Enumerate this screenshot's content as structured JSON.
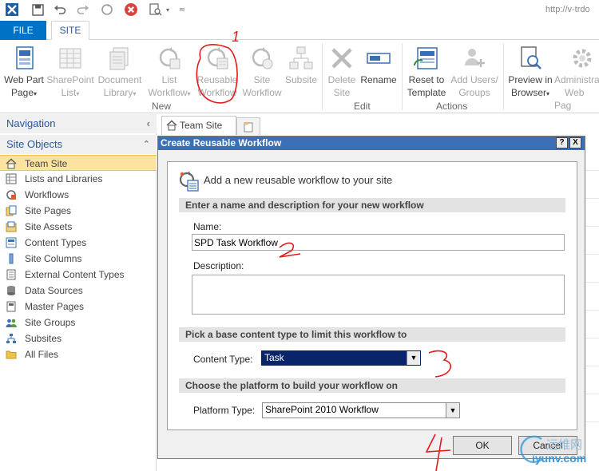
{
  "address": {
    "url": "http://v-trdo"
  },
  "quick_access": {
    "icons": [
      "sharepoint-designer-icon",
      "save-icon",
      "undo-icon",
      "redo-icon",
      "refresh-icon",
      "stop-icon",
      "preview-icon",
      "customize-icon"
    ]
  },
  "tabs": {
    "file": "FILE",
    "site": "SITE"
  },
  "ribbon": {
    "web_part_page": {
      "line1": "Web Part",
      "line2": "Page"
    },
    "sharepoint_list": {
      "line1": "SharePoint",
      "line2": "List"
    },
    "document_library": {
      "line1": "Document",
      "line2": "Library"
    },
    "list_workflow": {
      "line1": "List",
      "line2": "Workflow"
    },
    "reusable_workflow": {
      "line1": "Reusable",
      "line2": "Workflow"
    },
    "site_workflow": {
      "line1": "Site",
      "line2": "Workflow"
    },
    "subsite": {
      "line1": "Subsite"
    },
    "delete_site": {
      "line1": "Delete",
      "line2": "Site"
    },
    "rename": {
      "line1": "Rename"
    },
    "reset_to_template": {
      "line1": "Reset to",
      "line2": "Template"
    },
    "add_users_groups": {
      "line1": "Add Users/",
      "line2": "Groups"
    },
    "preview_in_browser": {
      "line1": "Preview in",
      "line2": "Browser"
    },
    "administration_web_page": {
      "line1": "Administra",
      "line2": "Web Pag"
    },
    "groups": {
      "new": "New",
      "edit": "Edit",
      "actions": "Actions"
    }
  },
  "navigation": {
    "header": "Navigation",
    "site_objects_header": "Site Objects",
    "items": [
      {
        "label": "Team Site",
        "icon": "home-icon"
      },
      {
        "label": "Lists and Libraries",
        "icon": "lists-icon"
      },
      {
        "label": "Workflows",
        "icon": "workflow-icon"
      },
      {
        "label": "Site Pages",
        "icon": "pages-icon"
      },
      {
        "label": "Site Assets",
        "icon": "assets-icon"
      },
      {
        "label": "Content Types",
        "icon": "content-types-icon"
      },
      {
        "label": "Site Columns",
        "icon": "columns-icon"
      },
      {
        "label": "External Content Types",
        "icon": "external-content-icon"
      },
      {
        "label": "Data Sources",
        "icon": "database-icon"
      },
      {
        "label": "Master Pages",
        "icon": "master-pages-icon"
      },
      {
        "label": "Site Groups",
        "icon": "users-icon"
      },
      {
        "label": "Subsites",
        "icon": "subsites-icon"
      },
      {
        "label": "All Files",
        "icon": "folder-icon"
      }
    ]
  },
  "doc_tab": {
    "label": "Team Site"
  },
  "dialog": {
    "title": "Create Reusable Workflow",
    "help_button": "?",
    "close_button": "X",
    "intro": "Add a new reusable workflow to your site",
    "section_name": "Enter a name and description for your new workflow",
    "name_label": "Name:",
    "name_value": "SPD Task Workflow",
    "description_label": "Description:",
    "description_value": "",
    "section_content_type": "Pick a base content type to limit this workflow to",
    "content_type_label": "Content Type:",
    "content_type_value": "Task",
    "section_platform": "Choose the platform to build your workflow on",
    "platform_label": "Platform Type:",
    "platform_value": "SharePoint 2010 Workflow",
    "ok": "OK",
    "cancel": "Cancel"
  },
  "annotations": [
    "1",
    "2",
    "3",
    "4"
  ],
  "watermark": {
    "brand": "运维网",
    "url": "iyunv.com"
  },
  "colors": {
    "file_tab": "#0072c6",
    "title_bar": "#3a70b5",
    "selected_nav": "#fce4a0",
    "selected_dropdown": "#0a246a",
    "annotation_red": "#e11b1b"
  }
}
